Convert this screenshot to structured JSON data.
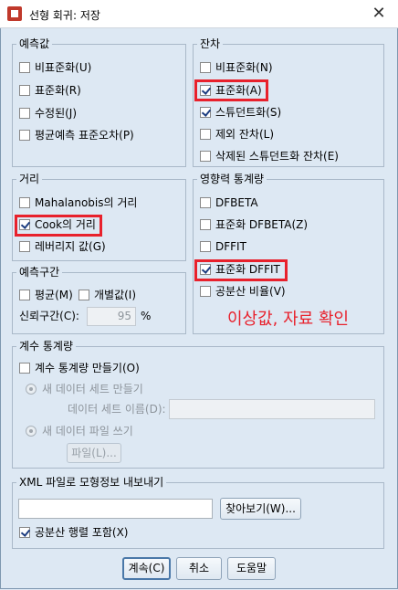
{
  "window": {
    "title": "선형 회귀: 저장",
    "close_glyph": "✕"
  },
  "predicted": {
    "legend": "예측값",
    "items": [
      {
        "label": "비표준화(U)",
        "checked": false
      },
      {
        "label": "표준화(R)",
        "checked": false
      },
      {
        "label": "수정된(J)",
        "checked": false
      },
      {
        "label": "평균예측 표준오차(P)",
        "checked": false
      }
    ]
  },
  "residuals": {
    "legend": "잔차",
    "items": [
      {
        "label": "비표준화(N)",
        "checked": false
      },
      {
        "label": "표준화(A)",
        "checked": true
      },
      {
        "label": "스튜던트화(S)",
        "checked": true
      },
      {
        "label": "제외 잔차(L)",
        "checked": false
      },
      {
        "label": "삭제된 스튜던트화 잔차(E)",
        "checked": false
      }
    ]
  },
  "distances": {
    "legend": "거리",
    "items": [
      {
        "label": "Mahalanobis의 거리",
        "checked": false
      },
      {
        "label": "Cook의 거리",
        "checked": true
      },
      {
        "label": "레버리지 값(G)",
        "checked": false
      }
    ]
  },
  "influence": {
    "legend": "영향력 통계량",
    "items": [
      {
        "label": "DFBETA",
        "checked": false
      },
      {
        "label": "표준화 DFBETA(Z)",
        "checked": false
      },
      {
        "label": "DFFIT",
        "checked": false
      },
      {
        "label": "표준화 DFFIT",
        "checked": true
      },
      {
        "label": "공분산 비율(V)",
        "checked": false
      }
    ]
  },
  "prediction_interval": {
    "legend": "예측구간",
    "mean_label": "평균(M)",
    "individual_label": "개별값(I)",
    "confidence_label": "신뢰구간(C):",
    "confidence_value": "95",
    "percent": "%"
  },
  "coef_stats": {
    "legend": "계수 통계량",
    "create_label": "계수 통계량 만들기(O)",
    "new_dataset_label": "새 데이터 세트 만들기",
    "dataset_name_label": "데이터 세트 이름(D):",
    "new_file_label": "새 데이터 파일 쓰기",
    "file_button": "파일(L)..."
  },
  "xml_export": {
    "legend": "XML 파일로 모형정보 내보내기",
    "path_value": "",
    "browse_button": "찾아보기(W)...",
    "include_cov_label": "공분산 행렬 포함(X)",
    "include_cov_checked": true
  },
  "buttons": {
    "continue": "계속(C)",
    "cancel": "취소",
    "help": "도움말"
  },
  "annotation": "이상값, 자료 확인",
  "colors": {
    "highlight": "#e8212c",
    "background": "#dde8f3"
  }
}
